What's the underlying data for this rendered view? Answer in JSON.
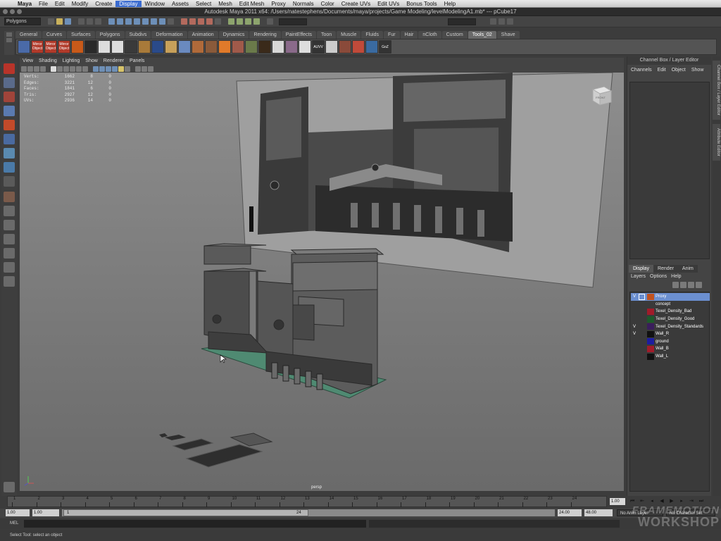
{
  "menubar": {
    "items": [
      "Maya",
      "File",
      "Edit",
      "Modify",
      "Create",
      "Display",
      "Window",
      "Assets",
      "Select",
      "Mesh",
      "Edit Mesh",
      "Proxy",
      "Normals",
      "Color",
      "Create UVs",
      "Edit UVs",
      "Bonus Tools",
      "Help"
    ],
    "active": "Display"
  },
  "window": {
    "title": "Autodesk Maya 2011 x64: /Users/natestephens/Documents/maya/projects/Game Modeling/levelModelingA1.mb*  ---  pCube17"
  },
  "statusline": {
    "menuset": "Polygons"
  },
  "shelf": {
    "tabs": [
      "General",
      "Curves",
      "Surfaces",
      "Polygons",
      "Subdivs",
      "Deformation",
      "Animation",
      "Dynamics",
      "Rendering",
      "PaintEffects",
      "Toon",
      "Muscle",
      "Fluids",
      "Fur",
      "Hair",
      "nCloth",
      "Custom",
      "Tools_02",
      "Shave"
    ],
    "active_tab": "Tools_02",
    "icon_labels": [
      "Mirror Object",
      "Mirror Object",
      "Mirror Object",
      "AUVV",
      "GoZ"
    ]
  },
  "panel": {
    "menu": [
      "View",
      "Shading",
      "Lighting",
      "Show",
      "Renderer",
      "Panels"
    ],
    "camera_label": "persp",
    "viewcube_label": "FRONT"
  },
  "hud": {
    "rows": [
      {
        "label": "Verts:",
        "a": "1662",
        "b": "8",
        "c": "0"
      },
      {
        "label": "Edges:",
        "a": "3221",
        "b": "12",
        "c": "0"
      },
      {
        "label": "Faces:",
        "a": "1841",
        "b": "6",
        "c": "0"
      },
      {
        "label": "Tris:",
        "a": "2927",
        "b": "12",
        "c": "0"
      },
      {
        "label": "UVs:",
        "a": "2936",
        "b": "14",
        "c": "0"
      }
    ]
  },
  "channel_box": {
    "header": "Channel Box / Layer Editor",
    "menu": [
      "Channels",
      "Edit",
      "Object",
      "Show"
    ]
  },
  "layer_editor": {
    "tabs": [
      "Display",
      "Render",
      "Anim"
    ],
    "active_tab": "Display",
    "menu": [
      "Layers",
      "Options",
      "Help"
    ],
    "layers": [
      {
        "name": "Proxy",
        "visible": "V",
        "color": "#c0521f",
        "selected": true
      },
      {
        "name": "concept",
        "visible": "",
        "color": "#3a3a3a",
        "selected": false
      },
      {
        "name": "Texel_Density_Bad",
        "visible": "",
        "color": "#a11c2a",
        "selected": false
      },
      {
        "name": "Texel_Density_Good",
        "visible": "",
        "color": "#1d5a2b",
        "selected": false
      },
      {
        "name": "Texel_Density_Standards",
        "visible": "V",
        "color": "#3a1e5c",
        "selected": false
      },
      {
        "name": "Wall_R",
        "visible": "V",
        "color": "#111111",
        "selected": false
      },
      {
        "name": "ground",
        "visible": "",
        "color": "#1d1da0",
        "selected": false
      },
      {
        "name": "Wall_B",
        "visible": "",
        "color": "#a11c2a",
        "selected": false
      },
      {
        "name": "Wall_L",
        "visible": "",
        "color": "#111111",
        "selected": false
      }
    ]
  },
  "side_tabs": [
    "Channel Box / Layer Editor",
    "Attribute Editor"
  ],
  "timeline": {
    "ticks": [
      "1",
      "2",
      "3",
      "4",
      "5",
      "6",
      "7",
      "8",
      "9",
      "10",
      "11",
      "12",
      "13",
      "14",
      "15",
      "16",
      "17",
      "18",
      "19",
      "20",
      "21",
      "22",
      "23",
      "24"
    ],
    "current_frame": "1.00"
  },
  "range": {
    "start": "1.00",
    "anim_start": "1.00",
    "range_start_label": "1",
    "range_end_label": "24",
    "anim_end": "24.00",
    "end": "48.00",
    "anim_layer": "No Anim Layer",
    "char_set": "No Character Set"
  },
  "command": {
    "label": "MEL"
  },
  "help_line": "Select Tool: select an object",
  "watermark": {
    "line1": "FRAMEMOTION",
    "line2": "WORKSHOP"
  },
  "colors": {
    "selection": "#6b8fd0",
    "viewport_top": "#8e8e8e",
    "viewport_bottom": "#6a6a6a",
    "base_platform": "#4f8a72"
  }
}
